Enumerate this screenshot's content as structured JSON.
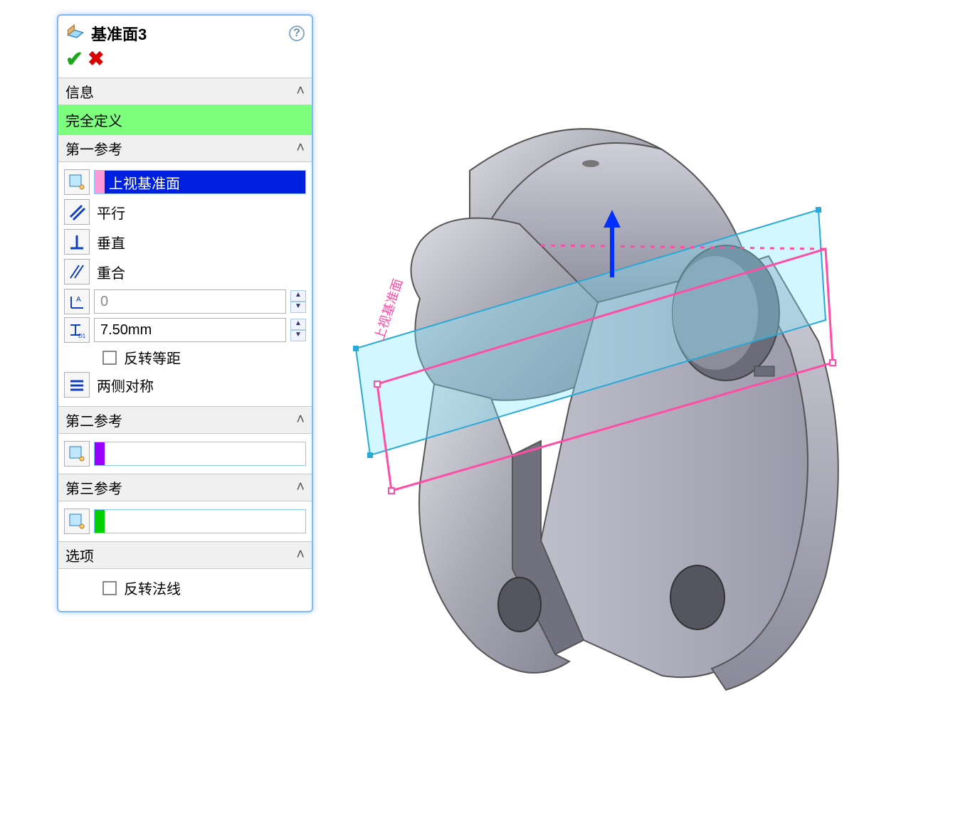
{
  "panel": {
    "title": "基准面3",
    "sections": {
      "info": {
        "label": "信息",
        "status": "完全定义"
      },
      "ref1": {
        "label": "第一参考",
        "selection": "上视基准面",
        "sel_color": "#ff9ad8",
        "opts": {
          "parallel": "平行",
          "perp": "垂直",
          "coincident": "重合",
          "angle_value": "0",
          "offset_value": "7.50mm",
          "flip_offset": "反转等距",
          "mid_plane": "两侧对称"
        }
      },
      "ref2": {
        "label": "第二参考",
        "sel_color": "#9a00ff"
      },
      "ref3": {
        "label": "第三参考",
        "sel_color": "#00d000"
      },
      "options": {
        "label": "选项",
        "flip_normal": "反转法线"
      }
    }
  },
  "viewport": {
    "plane_label": "上视基准面"
  }
}
